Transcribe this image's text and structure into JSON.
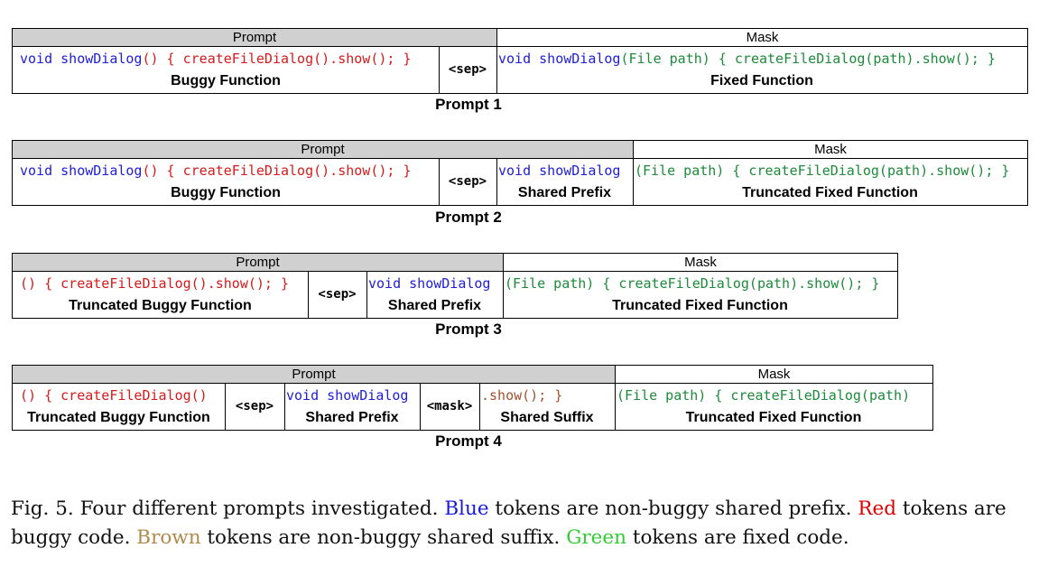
{
  "headers": {
    "prompt": "Prompt",
    "mask": "Mask"
  },
  "tokens": {
    "sep": "<sep>",
    "mask": "<mask>",
    "prefix": "void showDialog",
    "buggy_args": "() { createFileDialog().show(); }",
    "buggy_args_short": "() { createFileDialog()",
    "suffix": ".show(); }",
    "fixed_args": "(File path) { createFileDialog(path).show(); }",
    "fixed_args_short": "(File path) { createFileDialog(path)"
  },
  "labels": {
    "buggy_function": "Buggy Function",
    "fixed_function": "Fixed Function",
    "shared_prefix": "Shared Prefix",
    "truncated_fixed_function": "Truncated Fixed Function",
    "truncated_buggy_function": "Truncated Buggy Function",
    "shared_suffix": "Shared Suffix"
  },
  "prompts": {
    "p1": {
      "title": "Prompt 1"
    },
    "p2": {
      "title": "Prompt 2"
    },
    "p3": {
      "title": "Prompt 3"
    },
    "p4": {
      "title": "Prompt 4"
    }
  },
  "caption": {
    "prefix": "Fig. 5.  Four different prompts investigated. ",
    "blue_word": "Blue",
    "blue_rest": " tokens are non-buggy shared prefix. ",
    "red_word": "Red",
    "red_rest": " tokens are buggy code. ",
    "brown_word": "Brown",
    "brown_rest": " tokens are non-buggy shared suffix. ",
    "green_word": "Green",
    "green_rest": " tokens are fixed code."
  },
  "colors": {
    "prefix_blue": "#1d1dd6",
    "buggy_red": "#d61a1a",
    "suffix_brown": "#a0522d",
    "fixed_green": "#1d8a3a",
    "prompt_header_gray": "#d0d0d0"
  }
}
